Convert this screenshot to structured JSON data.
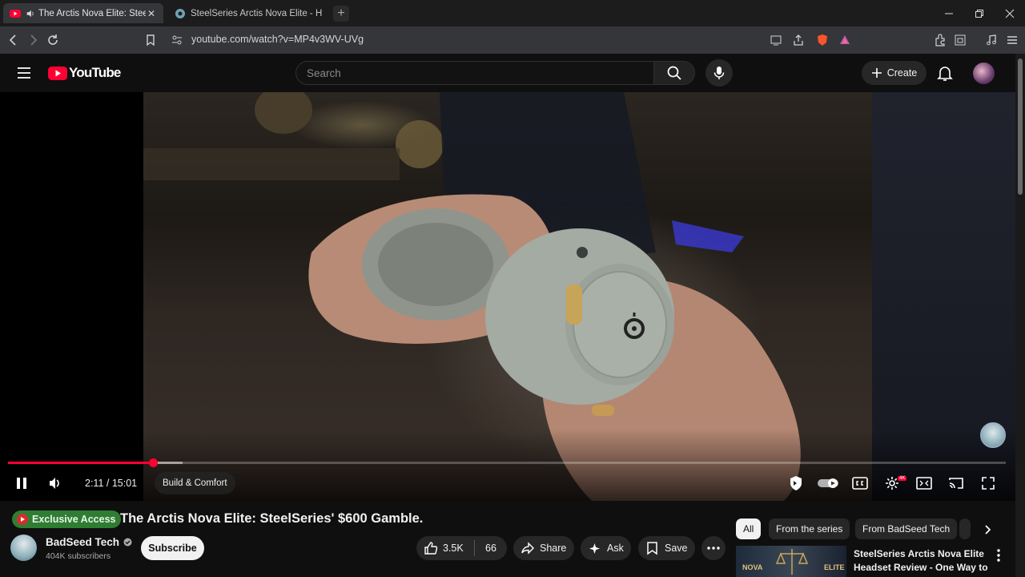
{
  "browser": {
    "tabs": [
      {
        "label": "The Arctis Nova Elite: SteelSer",
        "active": true
      },
      {
        "label": "SteelSeries Arctis Nova Elite - Hi-Res",
        "active": false
      }
    ],
    "new_tab": "+",
    "url": "youtube.com/watch?v=MP4v3WV-UVg"
  },
  "youtube": {
    "logo_text": "YouTube",
    "search_placeholder": "Search",
    "create_label": "Create"
  },
  "player": {
    "current_time": "2:11",
    "duration": "15:01",
    "time_display": "2:11 / 15:01",
    "progress_fraction": 0.1454,
    "buffered_fraction": 0.175,
    "chapter": "Build & Comfort",
    "hd_badge": "4K",
    "state": "playing"
  },
  "video": {
    "badge": "Exclusive Access",
    "title": "The Arctis Nova Elite: SteelSeries' $600 Gamble.",
    "channel": "BadSeed Tech",
    "subscribers": "404K subscribers",
    "subscribe_label": "Subscribe",
    "likes": "3.5K",
    "dislikes": "66",
    "share_label": "Share",
    "ask_label": "Ask",
    "save_label": "Save"
  },
  "sidebar": {
    "chips": [
      "All",
      "From the series",
      "From BadSeed Tech"
    ],
    "selected_chip": "All",
    "recommended": {
      "title": "SteelSeries Arctis Nova Elite Headset Review - One Way to ...",
      "thumb_left": "NOVA",
      "thumb_right": "ELITE"
    }
  },
  "colors": {
    "youtube_red": "#ff0033",
    "accent_green": "#2e7d32",
    "background": "#0f0f0f"
  }
}
